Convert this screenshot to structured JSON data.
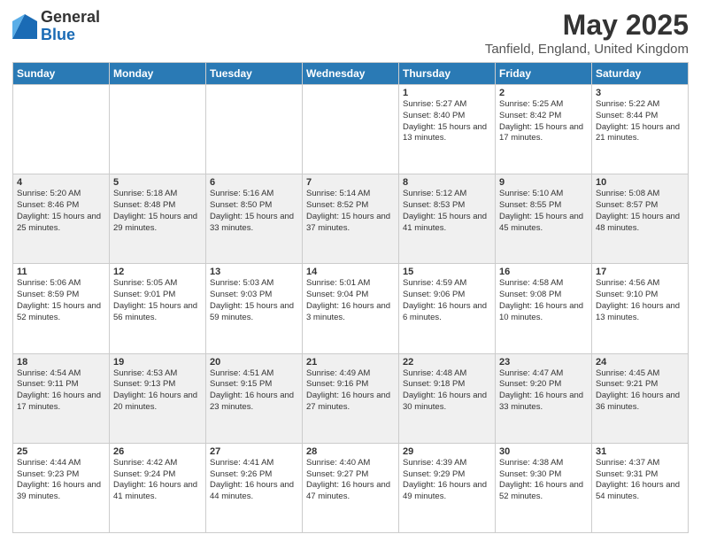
{
  "header": {
    "logo": {
      "general": "General",
      "blue": "Blue"
    },
    "title": "May 2025",
    "location": "Tanfield, England, United Kingdom"
  },
  "days_of_week": [
    "Sunday",
    "Monday",
    "Tuesday",
    "Wednesday",
    "Thursday",
    "Friday",
    "Saturday"
  ],
  "weeks": [
    [
      {
        "day": "",
        "info": ""
      },
      {
        "day": "",
        "info": ""
      },
      {
        "day": "",
        "info": ""
      },
      {
        "day": "",
        "info": ""
      },
      {
        "day": "1",
        "info": "Sunrise: 5:27 AM\nSunset: 8:40 PM\nDaylight: 15 hours\nand 13 minutes."
      },
      {
        "day": "2",
        "info": "Sunrise: 5:25 AM\nSunset: 8:42 PM\nDaylight: 15 hours\nand 17 minutes."
      },
      {
        "day": "3",
        "info": "Sunrise: 5:22 AM\nSunset: 8:44 PM\nDaylight: 15 hours\nand 21 minutes."
      }
    ],
    [
      {
        "day": "4",
        "info": "Sunrise: 5:20 AM\nSunset: 8:46 PM\nDaylight: 15 hours\nand 25 minutes."
      },
      {
        "day": "5",
        "info": "Sunrise: 5:18 AM\nSunset: 8:48 PM\nDaylight: 15 hours\nand 29 minutes."
      },
      {
        "day": "6",
        "info": "Sunrise: 5:16 AM\nSunset: 8:50 PM\nDaylight: 15 hours\nand 33 minutes."
      },
      {
        "day": "7",
        "info": "Sunrise: 5:14 AM\nSunset: 8:52 PM\nDaylight: 15 hours\nand 37 minutes."
      },
      {
        "day": "8",
        "info": "Sunrise: 5:12 AM\nSunset: 8:53 PM\nDaylight: 15 hours\nand 41 minutes."
      },
      {
        "day": "9",
        "info": "Sunrise: 5:10 AM\nSunset: 8:55 PM\nDaylight: 15 hours\nand 45 minutes."
      },
      {
        "day": "10",
        "info": "Sunrise: 5:08 AM\nSunset: 8:57 PM\nDaylight: 15 hours\nand 48 minutes."
      }
    ],
    [
      {
        "day": "11",
        "info": "Sunrise: 5:06 AM\nSunset: 8:59 PM\nDaylight: 15 hours\nand 52 minutes."
      },
      {
        "day": "12",
        "info": "Sunrise: 5:05 AM\nSunset: 9:01 PM\nDaylight: 15 hours\nand 56 minutes."
      },
      {
        "day": "13",
        "info": "Sunrise: 5:03 AM\nSunset: 9:03 PM\nDaylight: 15 hours\nand 59 minutes."
      },
      {
        "day": "14",
        "info": "Sunrise: 5:01 AM\nSunset: 9:04 PM\nDaylight: 16 hours\nand 3 minutes."
      },
      {
        "day": "15",
        "info": "Sunrise: 4:59 AM\nSunset: 9:06 PM\nDaylight: 16 hours\nand 6 minutes."
      },
      {
        "day": "16",
        "info": "Sunrise: 4:58 AM\nSunset: 9:08 PM\nDaylight: 16 hours\nand 10 minutes."
      },
      {
        "day": "17",
        "info": "Sunrise: 4:56 AM\nSunset: 9:10 PM\nDaylight: 16 hours\nand 13 minutes."
      }
    ],
    [
      {
        "day": "18",
        "info": "Sunrise: 4:54 AM\nSunset: 9:11 PM\nDaylight: 16 hours\nand 17 minutes."
      },
      {
        "day": "19",
        "info": "Sunrise: 4:53 AM\nSunset: 9:13 PM\nDaylight: 16 hours\nand 20 minutes."
      },
      {
        "day": "20",
        "info": "Sunrise: 4:51 AM\nSunset: 9:15 PM\nDaylight: 16 hours\nand 23 minutes."
      },
      {
        "day": "21",
        "info": "Sunrise: 4:49 AM\nSunset: 9:16 PM\nDaylight: 16 hours\nand 27 minutes."
      },
      {
        "day": "22",
        "info": "Sunrise: 4:48 AM\nSunset: 9:18 PM\nDaylight: 16 hours\nand 30 minutes."
      },
      {
        "day": "23",
        "info": "Sunrise: 4:47 AM\nSunset: 9:20 PM\nDaylight: 16 hours\nand 33 minutes."
      },
      {
        "day": "24",
        "info": "Sunrise: 4:45 AM\nSunset: 9:21 PM\nDaylight: 16 hours\nand 36 minutes."
      }
    ],
    [
      {
        "day": "25",
        "info": "Sunrise: 4:44 AM\nSunset: 9:23 PM\nDaylight: 16 hours\nand 39 minutes."
      },
      {
        "day": "26",
        "info": "Sunrise: 4:42 AM\nSunset: 9:24 PM\nDaylight: 16 hours\nand 41 minutes."
      },
      {
        "day": "27",
        "info": "Sunrise: 4:41 AM\nSunset: 9:26 PM\nDaylight: 16 hours\nand 44 minutes."
      },
      {
        "day": "28",
        "info": "Sunrise: 4:40 AM\nSunset: 9:27 PM\nDaylight: 16 hours\nand 47 minutes."
      },
      {
        "day": "29",
        "info": "Sunrise: 4:39 AM\nSunset: 9:29 PM\nDaylight: 16 hours\nand 49 minutes."
      },
      {
        "day": "30",
        "info": "Sunrise: 4:38 AM\nSunset: 9:30 PM\nDaylight: 16 hours\nand 52 minutes."
      },
      {
        "day": "31",
        "info": "Sunrise: 4:37 AM\nSunset: 9:31 PM\nDaylight: 16 hours\nand 54 minutes."
      }
    ]
  ]
}
